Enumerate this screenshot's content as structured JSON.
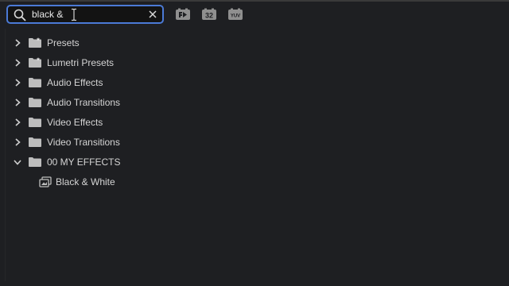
{
  "search": {
    "value": "black &",
    "placeholder": ""
  },
  "filters": [
    {
      "name": "accelerated-effects-filter",
      "label": ""
    },
    {
      "name": "32-bit-filter",
      "label": "32"
    },
    {
      "name": "yuv-filter",
      "label": "YUV"
    }
  ],
  "tree": {
    "items": [
      {
        "label": "Presets",
        "expanded": false,
        "icon": "preset-folder-icon"
      },
      {
        "label": "Lumetri Presets",
        "expanded": false,
        "icon": "preset-folder-icon"
      },
      {
        "label": "Audio Effects",
        "expanded": false,
        "icon": "folder-icon"
      },
      {
        "label": "Audio Transitions",
        "expanded": false,
        "icon": "folder-icon"
      },
      {
        "label": "Video Effects",
        "expanded": false,
        "icon": "folder-icon"
      },
      {
        "label": "Video Transitions",
        "expanded": false,
        "icon": "folder-icon"
      },
      {
        "label": "00 MY EFFECTS",
        "expanded": true,
        "icon": "folder-icon"
      }
    ],
    "child": {
      "label": "Black & White",
      "icon": "effect-icon"
    }
  },
  "colors": {
    "background": "#1e1f22",
    "accent": "#4b7ad6",
    "text": "#d4d4d4",
    "icon": "#bdbdbd"
  }
}
